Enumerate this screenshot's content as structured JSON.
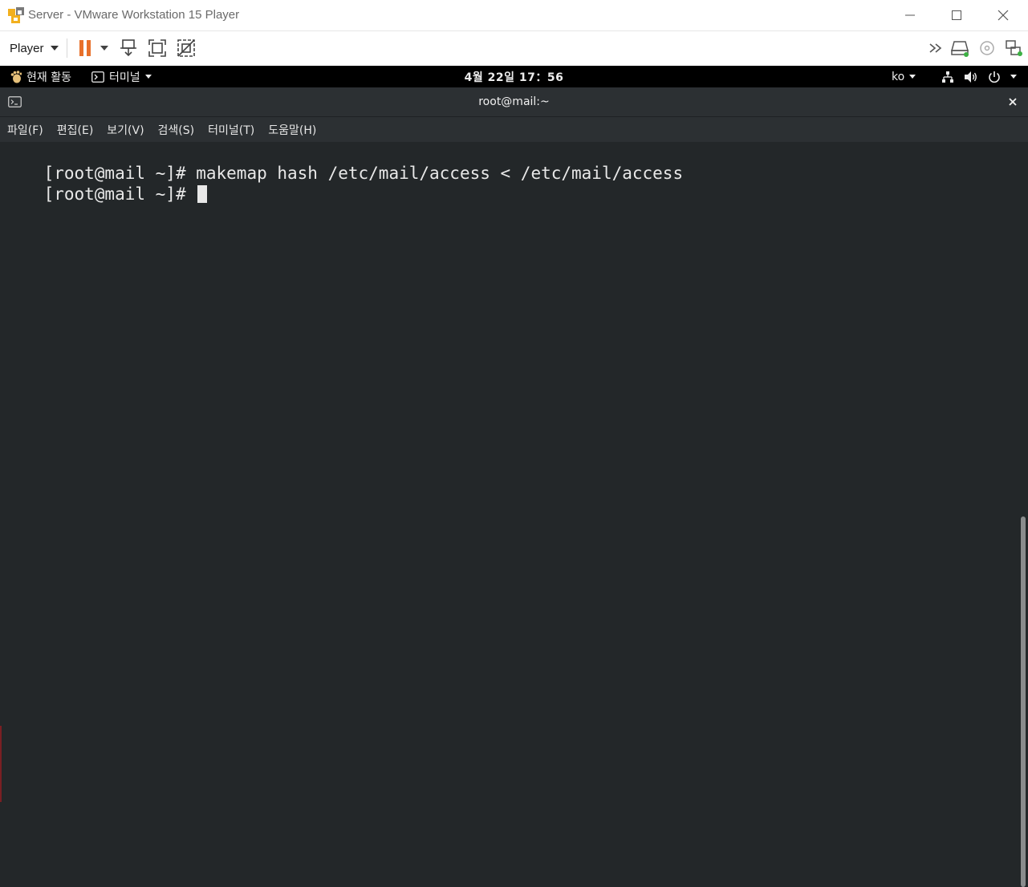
{
  "host_window": {
    "title": "Server - VMware Workstation 15 Player",
    "player_menu_label": "Player",
    "icons": {
      "app": "vmware-player-icon",
      "minimize": "minimize-icon",
      "maximize": "maximize-icon",
      "close": "close-icon",
      "pause": "pause-icon",
      "send_ctrl_alt_del": "send-ctrl-alt-del-icon",
      "fullscreen": "fullscreen-icon",
      "unity": "unity-icon",
      "more": "double-chevron-right-icon",
      "hard_disk": "hard-disk-icon",
      "cd_dvd": "cd-dvd-icon",
      "network_adapter": "network-adapter-icon"
    },
    "colors": {
      "pause_accent": "#e8702a",
      "device_active": "#3cb043"
    }
  },
  "gnome_top_bar": {
    "activities_label": "현재 활동",
    "app_menu_label": "터미널",
    "clock": "4월 22일  17：56",
    "input_method": "ko",
    "icons": {
      "activities": "gnome-foot-icon",
      "app_menu": "terminal-icon",
      "network": "network-wired-icon",
      "volume": "volume-icon",
      "power": "power-icon"
    }
  },
  "terminal": {
    "title": "root@mail:~",
    "menu": [
      "파일(F)",
      "편집(E)",
      "보기(V)",
      "검색(S)",
      "터미널(T)",
      "도움말(H)"
    ],
    "lines": [
      "[root@mail ~]# makemap hash /etc/mail/access < /etc/mail/access",
      "[root@mail ~]# "
    ],
    "colors": {
      "background": "#232729",
      "header": "#2c3033",
      "text": "#e8e8e8"
    }
  }
}
